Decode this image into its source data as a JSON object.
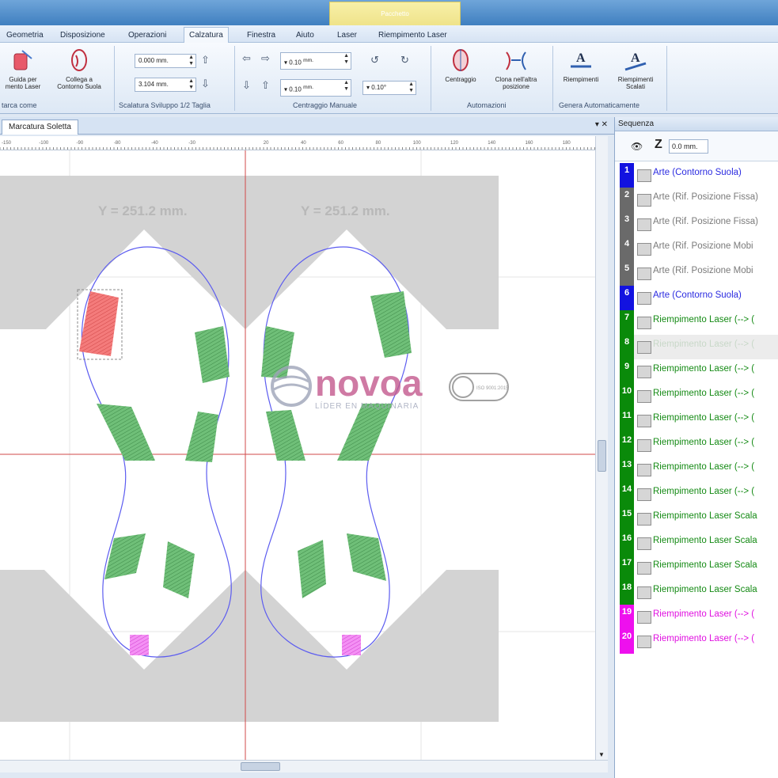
{
  "titlebar": {
    "context_tab": "Pacchetto"
  },
  "tabs": [
    "Geometria",
    "Disposizione",
    "Operazioni",
    "Calzatura",
    "Finestra",
    "Aiuto",
    "Laser",
    "Riempimento Laser"
  ],
  "active_tab": "Calzatura",
  "ribbon": {
    "btn_guida": "Guida per\nmento Laser",
    "btn_collega": "Collega a\nContorno Suola",
    "group1_label": "tarca come",
    "spin_top": "0.000 mm.",
    "spin_bottom": "3.104 mm.",
    "group2_label": "Scalatura Sviluppo 1/2 Taglia",
    "cent_spin1": "0.10",
    "cent_spin1_unit": "mm.",
    "cent_spin2": "0.10",
    "cent_spin2_unit": "mm.",
    "cent_angle": "0.10°",
    "group3_label": "Centraggio Manuale",
    "btn_centraggio": "Centraggio",
    "btn_clona": "Clona nell'altra\nposizione",
    "group4_label": "Automazioni",
    "btn_riempimenti": "Riempimenti",
    "btn_riempimenti_scalati": "Riempimenti\nScalati",
    "group5_label": "Genera Automaticamente"
  },
  "document": {
    "tab_label": "Marcatura Soletta",
    "ctrl": "▾ ✕",
    "ruler_ticks": [
      "-150",
      "-100",
      "-90",
      "-80",
      "-40",
      "-30",
      "",
      "20",
      "40",
      "60",
      "80",
      "100",
      "120",
      "140",
      "160",
      "180"
    ],
    "y_label_left": "Y = 251.2 mm.",
    "y_label_right": "Y = 251.2 mm."
  },
  "watermark": {
    "brand": "novoa",
    "tagline": "LÍDER EN MAQUINARIA",
    "cert": "ISO 9001:2015"
  },
  "sequence": {
    "title": "Sequenza",
    "z_label": "Z",
    "z_value": "0.0 mm.",
    "rows": [
      {
        "n": "1",
        "label": "Arte (Contorno Suola)",
        "num_color": "#1212e0",
        "text_color": "#2a2ae0"
      },
      {
        "n": "2",
        "label": "Arte (Rif. Posizione Fissa)",
        "num_color": "#6a6a6a",
        "text_color": "#7a7a7a"
      },
      {
        "n": "3",
        "label": "Arte (Rif. Posizione Fissa)",
        "num_color": "#6a6a6a",
        "text_color": "#7a7a7a"
      },
      {
        "n": "4",
        "label": "Arte (Rif. Posizione Mobi",
        "num_color": "#6a6a6a",
        "text_color": "#7a7a7a"
      },
      {
        "n": "5",
        "label": "Arte (Rif. Posizione Mobi",
        "num_color": "#6a6a6a",
        "text_color": "#7a7a7a"
      },
      {
        "n": "6",
        "label": "Arte (Contorno Suola)",
        "num_color": "#1212e0",
        "text_color": "#2a2ae0"
      },
      {
        "n": "7",
        "label": "Riempimento Laser (--> (",
        "num_color": "#0a8a0a",
        "text_color": "#148a14"
      },
      {
        "n": "8",
        "label": "Riempimento Laser (--> (",
        "num_color": "#0a8a0a",
        "text_color": "#c8d8c8"
      },
      {
        "n": "9",
        "label": "Riempimento Laser (--> (",
        "num_color": "#0a8a0a",
        "text_color": "#148a14"
      },
      {
        "n": "10",
        "label": "Riempimento Laser (--> (",
        "num_color": "#0a8a0a",
        "text_color": "#148a14"
      },
      {
        "n": "11",
        "label": "Riempimento Laser (--> (",
        "num_color": "#0a8a0a",
        "text_color": "#148a14"
      },
      {
        "n": "12",
        "label": "Riempimento Laser (--> (",
        "num_color": "#0a8a0a",
        "text_color": "#148a14"
      },
      {
        "n": "13",
        "label": "Riempimento Laser (--> (",
        "num_color": "#0a8a0a",
        "text_color": "#148a14"
      },
      {
        "n": "14",
        "label": "Riempimento Laser (--> (",
        "num_color": "#0a8a0a",
        "text_color": "#148a14"
      },
      {
        "n": "15",
        "label": "Riempimento Laser Scala",
        "num_color": "#0a8a0a",
        "text_color": "#148a14"
      },
      {
        "n": "16",
        "label": "Riempimento Laser Scala",
        "num_color": "#0a8a0a",
        "text_color": "#148a14"
      },
      {
        "n": "17",
        "label": "Riempimento Laser Scala",
        "num_color": "#0a8a0a",
        "text_color": "#148a14"
      },
      {
        "n": "18",
        "label": "Riempimento Laser Scala",
        "num_color": "#0a8a0a",
        "text_color": "#148a14"
      },
      {
        "n": "19",
        "label": "Riempimento Laser (--> (",
        "num_color": "#ee10ee",
        "text_color": "#e010e0"
      },
      {
        "n": "20",
        "label": "Riempimento Laser (--> (",
        "num_color": "#ee10ee",
        "text_color": "#e010e0"
      }
    ]
  },
  "colors": {
    "fill_green": "#5fae6a",
    "fill_red": "#f06a6a",
    "fill_magenta": "#f070f0",
    "contour_blue": "#5c5cf0",
    "fixture_gray": "#d3d3d3",
    "axis_red": "#d04a4a"
  }
}
